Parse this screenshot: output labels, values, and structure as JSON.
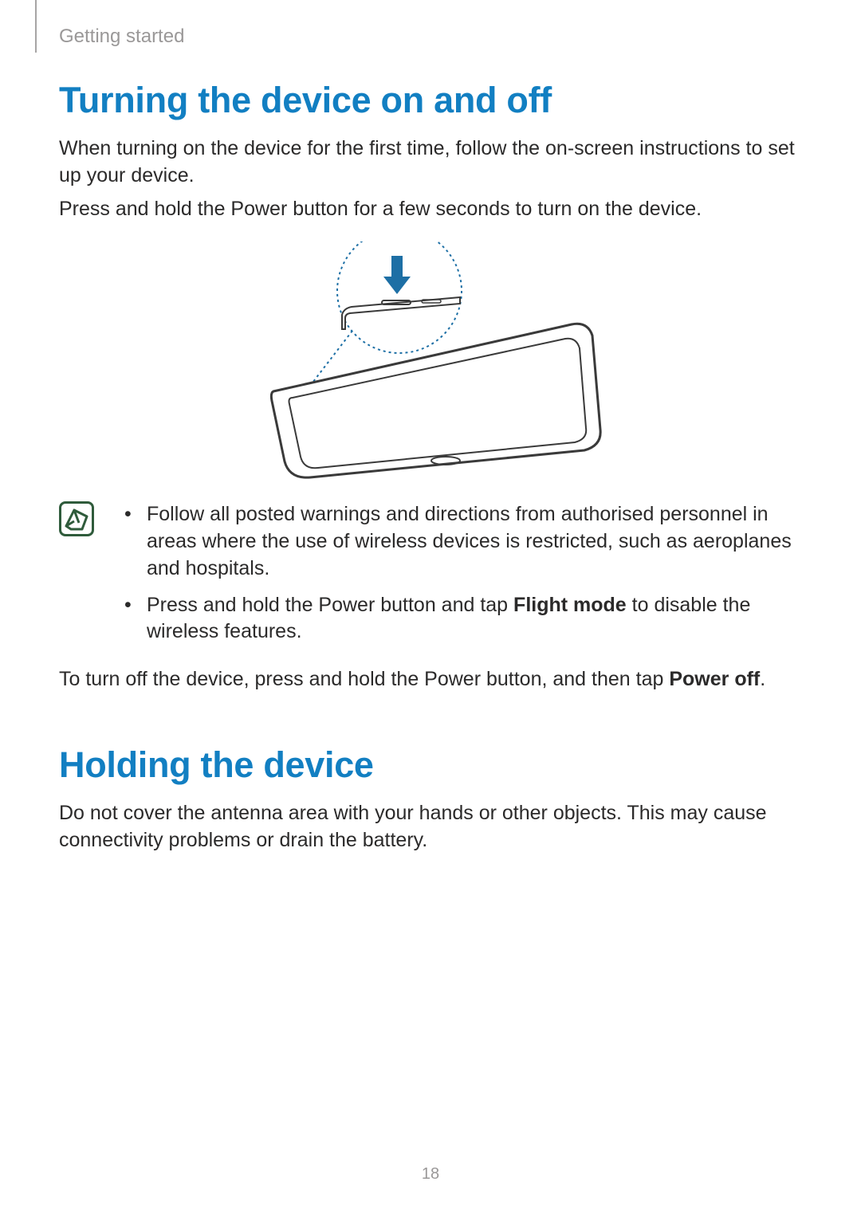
{
  "header": {
    "section": "Getting started"
  },
  "section1": {
    "title": "Turning the device on and off",
    "p1": "When turning on the device for the first time, follow the on-screen instructions to set up your device.",
    "p2": "Press and hold the Power button for a few seconds to turn on the device.",
    "note1_a": "Follow all posted warnings and directions from authorised personnel in areas where the use of wireless devices is restricted, such as aeroplanes and hospitals.",
    "note2_pre": "Press and hold the Power button and tap ",
    "note2_bold": "Flight mode",
    "note2_post": " to disable the wireless features.",
    "p3_pre": "To turn off the device, press and hold the Power button, and then tap ",
    "p3_bold": "Power off",
    "p3_post": "."
  },
  "section2": {
    "title": "Holding the device",
    "p1": "Do not cover the antenna area with your hands or other objects. This may cause connectivity problems or drain the battery."
  },
  "page_number": "18"
}
